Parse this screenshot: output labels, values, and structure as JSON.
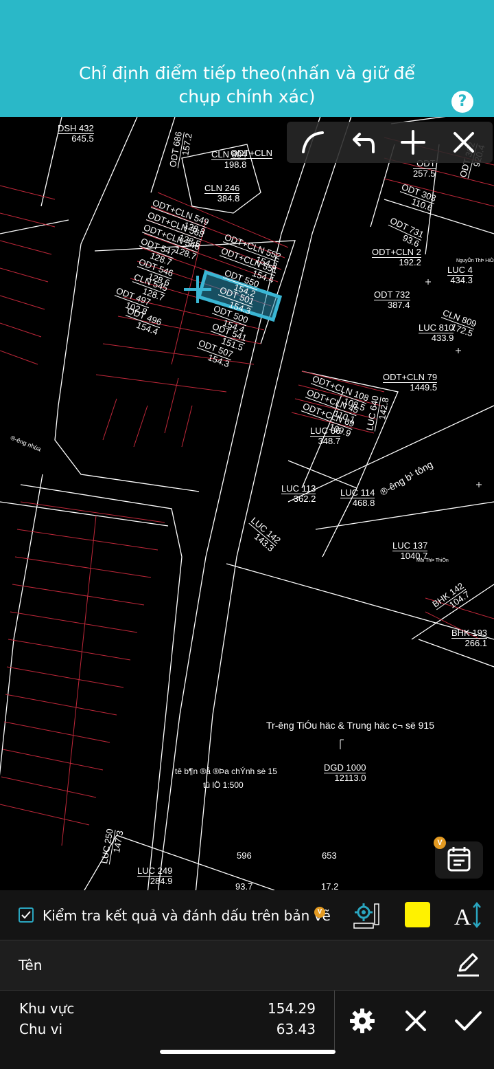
{
  "header": {
    "title": "Chỉ định điểm tiếp theo(nhấn và giữ để chụp chính xác)",
    "help_label": "?"
  },
  "toolbar": {
    "icons": [
      "arc-icon",
      "undo-icon",
      "add-point-icon",
      "close-icon"
    ]
  },
  "map": {
    "labels": [
      {
        "a": "DSH 432",
        "b": "645.5"
      },
      {
        "a": "CLN 804",
        "b": "198.8"
      },
      {
        "a": "CLN 246",
        "b": "384.8"
      },
      {
        "a": "ODT 686",
        "b": "157.2"
      },
      {
        "a": "ODT+CLN",
        "b": ""
      },
      {
        "a": "ODT",
        "b": "257.5"
      },
      {
        "a": "ODT 303",
        "b": "110.6"
      },
      {
        "a": "ODT 302",
        "b": "920.4"
      },
      {
        "a": "ODT+CLN 549",
        "b": "128.8"
      },
      {
        "a": "ODT+CLN 563",
        "b": "128.5"
      },
      {
        "a": "ODT+CLN 548",
        "b": "128.7"
      },
      {
        "a": "ODT 547",
        "b": "128.7"
      },
      {
        "a": "ODT 546",
        "b": "128.6"
      },
      {
        "a": "CLN 545",
        "b": "128.7"
      },
      {
        "a": "ODT 497",
        "b": "102.8"
      },
      {
        "a": "ODT 496",
        "b": "154.4"
      },
      {
        "a": "ODT+CLN 552",
        "b": "154.3"
      },
      {
        "a": "ODT+CLN 551",
        "b": "154.4"
      },
      {
        "a": "ODT 550",
        "b": "154.2"
      },
      {
        "a": "ODT 501",
        "b": "154.3"
      },
      {
        "a": "ODT 500",
        "b": "154.4"
      },
      {
        "a": "ODT 541",
        "b": "151.5"
      },
      {
        "a": "ODT 507",
        "b": "154.3"
      },
      {
        "a": "ODT 731",
        "b": "93.6"
      },
      {
        "a": "ODT+CLN 2",
        "b": "192.2"
      },
      {
        "a": "LUC 4",
        "b": "434.3"
      },
      {
        "a": "ODT 732",
        "b": "387.4"
      },
      {
        "a": "CLN 809",
        "b": "172.5"
      },
      {
        "a": "LUC 810",
        "b": "433.9"
      },
      {
        "a": "ODT+CLN 79",
        "b": "1449.5"
      },
      {
        "a": "ODT+CLN 108",
        "b": "108.5"
      },
      {
        "a": "ODT+CLN 45",
        "b": "110.1"
      },
      {
        "a": "ODT+CLN 69",
        "b": "109.9"
      },
      {
        "a": "LUC 66",
        "b": "348.7"
      },
      {
        "a": "LUC 640",
        "b": "142.8"
      },
      {
        "a": "LUC 113",
        "b": "362.2"
      },
      {
        "a": "LUC 114",
        "b": "468.8"
      },
      {
        "a": "LUC 142",
        "b": "143.3"
      },
      {
        "a": "LUC 137",
        "b": "1040.7"
      },
      {
        "a": "BHK 142",
        "b": "104.7"
      },
      {
        "a": "BHK 193",
        "b": "266.1"
      },
      {
        "a": "DGD 1000",
        "b": "12113.0"
      },
      {
        "a": "LUC 249",
        "b": "284.9"
      },
      {
        "a": "LUC 250",
        "b": "147.3"
      }
    ],
    "road_1": "®-êng nhùa",
    "road_2": "®-êng b¹ tông",
    "school": "Tr-êng TiÓu häc & Trung häc c¬ së 915",
    "sheet": "tê b¶n ®å ®Þa chÝnh sè 15",
    "scale": "tû lÖ 1:500",
    "n596": "596",
    "n653": "653",
    "n93": "93.7",
    "n17": "17.2",
    "nguyen": "NguyÔn ThÞ HiÒn",
    "thien": "Mai ThÞ ThiÒn"
  },
  "notes_badge": "V",
  "panel": {
    "check_label": "Kiểm tra kết quả và đánh dấu trên bản vẽ",
    "check_badge": "V",
    "highlight_color": "#fff200",
    "name_label": "Tên",
    "area_label": "Khu vực",
    "area_value": "154.29",
    "perimeter_label": "Chu vi",
    "perimeter_value": "63.43"
  },
  "colors": {
    "header": "#2ab8c8",
    "selection": "#3ab6d4",
    "parcel_line": "#c0283a"
  }
}
